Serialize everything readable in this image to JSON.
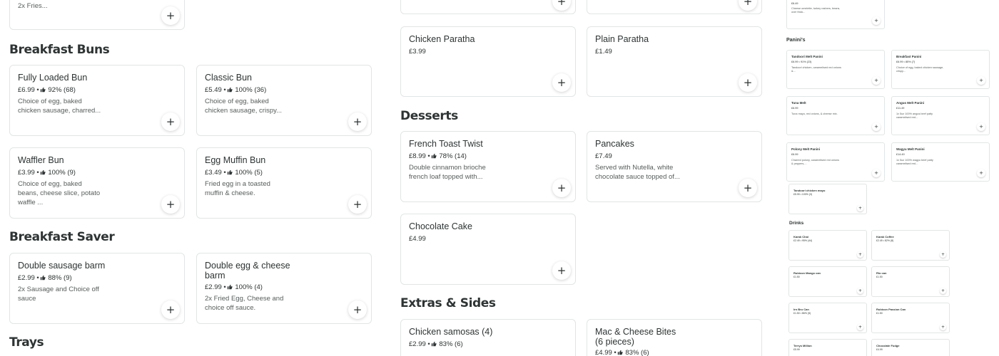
{
  "left": {
    "top_card": {
      "desc": "2x Fries..."
    },
    "breakfast_buns": {
      "title": "Breakfast Buns",
      "items": [
        {
          "name": "Fully Loaded Bun",
          "price": "£6.99",
          "rating": "92%",
          "count": "(68)",
          "desc": "Choice of egg, baked chicken sausage, charred..."
        },
        {
          "name": "Classic Bun",
          "price": "£5.49",
          "rating": "100%",
          "count": "(36)",
          "desc": "Choice of egg, baked chicken sausage, crispy..."
        },
        {
          "name": "Waffler Bun",
          "price": "£3.99",
          "rating": "100%",
          "count": "(9)",
          "desc": "Choice of egg, baked beans, cheese slice, potato waffle ..."
        },
        {
          "name": "Egg Muffin Bun",
          "price": "£3.49",
          "rating": "100%",
          "count": "(5)",
          "desc": "Fried egg in a toasted muffin & cheese."
        }
      ]
    },
    "breakfast_saver": {
      "title": "Breakfast Saver",
      "items": [
        {
          "name": "Double sausage barm",
          "price": "£2.99",
          "rating": "88%",
          "count": "(9)",
          "desc": "2x Sausage and Choice off sauce"
        },
        {
          "name": "Double egg & cheese barm",
          "price": "£2.99",
          "rating": "100%",
          "count": "(4)",
          "desc": "2x Fried Egg, Cheese and choice off sauce."
        }
      ]
    },
    "trays": {
      "title": "Trays"
    }
  },
  "middle": {
    "parathas": [
      {
        "name": "Chicken Paratha",
        "price": "£3.99"
      },
      {
        "name": "Plain Paratha",
        "price": "£1.49"
      }
    ],
    "desserts": {
      "title": "Desserts",
      "items": [
        {
          "name": "French Toast Twist",
          "price": "£8.99",
          "rating": "78%",
          "count": "(14)",
          "desc": "Double cinnamon brioche french loaf topped with..."
        },
        {
          "name": "Pancakes",
          "price": "£7.49",
          "desc": "Served with Nutella, white chocolate sauce topped of..."
        },
        {
          "name": "Chocolate Cake",
          "price": "£4.99"
        }
      ]
    },
    "extras": {
      "title": "Extras & Sides",
      "items": [
        {
          "name": "Chicken samosas (4)",
          "price": "£2.99",
          "rating": "83%",
          "count": "(6)"
        },
        {
          "name": "Mac & Cheese Bites (6 pieces)",
          "price": "£4.99",
          "rating": "83%",
          "count": "(6)"
        }
      ]
    }
  },
  "right": {
    "top_card": {
      "price": "£6.49",
      "desc": "Cheese omelette, turkey rashers, beans, over thick..."
    },
    "paninis": {
      "title": "Panini's",
      "items": [
        {
          "name": "Tandoori Melt Panini",
          "meta": "£6.99 • 91% (23)",
          "desc": "Tandoori chicken, caramelised red onions &..."
        },
        {
          "name": "Breakfast Panini",
          "meta": "£6.99 • 85% (7)",
          "desc": "Choice of egg, baked chicken sausage, crispy..."
        },
        {
          "name": "Tuna Melt",
          "meta": "£6.99",
          "desc": "Tuna mayo, red onions, & cheese mix."
        },
        {
          "name": "Angus Melt Panini",
          "meta": "£11.49",
          "desc": "1x 5oz 100% angus beef patty caramelised red..."
        },
        {
          "name": "Polony Melt Panini",
          "meta": "£6.99",
          "desc": "Charred polony, caramelised red onions & peppers,..."
        },
        {
          "name": "Wagyu Melt Panini",
          "meta": "£14.49",
          "desc": "1x 5oz 100% wagyu beef patty caramelised red..."
        },
        {
          "name": "Tandoori chicken mayo",
          "meta": "£5.99 • 100% (3)",
          "desc": ""
        }
      ]
    },
    "drinks": {
      "title": "Drinks",
      "items": [
        {
          "name": "Karak Chai",
          "meta": "£2.49 • 95% (44)"
        },
        {
          "name": "Karak Coffee",
          "meta": "£2.49 • 82% (8)"
        },
        {
          "name": "Rubicon Mango can",
          "meta": "£1.50"
        },
        {
          "name": "Rio can",
          "meta": "£1.50"
        },
        {
          "name": "Irn Bru Can",
          "meta": "£1.50 • 86% (5)"
        },
        {
          "name": "Rubicon Passion Can",
          "meta": "£1.50"
        },
        {
          "name": "Terrys Million",
          "meta": "£5.99"
        },
        {
          "name": "Chocolate Fudge",
          "meta": "£4.99"
        }
      ]
    }
  },
  "ui": {
    "add_symbol": "+",
    "dot": "•"
  }
}
